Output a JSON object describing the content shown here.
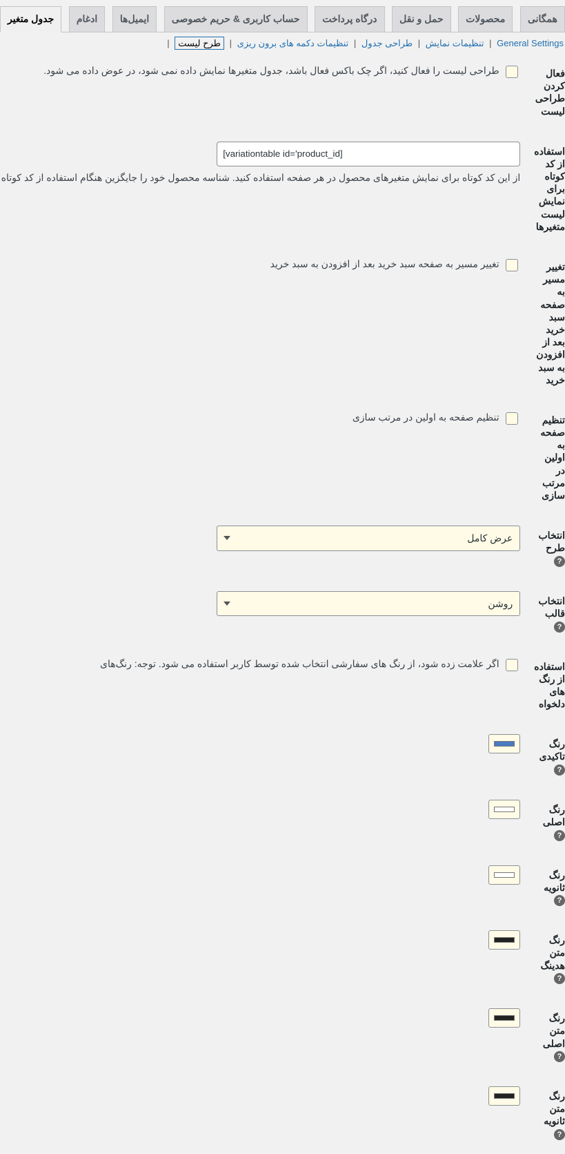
{
  "tabs": {
    "items": [
      {
        "label": "همگانی"
      },
      {
        "label": "محصولات"
      },
      {
        "label": "حمل و نقل"
      },
      {
        "label": "درگاه پرداخت"
      },
      {
        "label": "حساب کاربری & حریم خصوصی"
      },
      {
        "label": "ایمیل‌ها"
      },
      {
        "label": "ادغام"
      },
      {
        "label": "جدول متغیر"
      }
    ],
    "activeIndex": 7
  },
  "sublinks": {
    "items": [
      {
        "label": "General Settings"
      },
      {
        "label": "تنظیمات نمایش"
      },
      {
        "label": "طراحی جدول"
      },
      {
        "label": "تنظیمات دکمه های برون ریزی"
      },
      {
        "label": "طرح لیست"
      }
    ],
    "activeIndex": 4,
    "sep": "|"
  },
  "fields": {
    "enable_list": {
      "label": "فعال کردن طراحی لیست",
      "desc": "طراحی لیست را فعال کنید، اگر چک باکس فعال باشد، جدول متغیرها نمایش داده نمی شود، در عوض داده می شود."
    },
    "shortcode": {
      "label": "استفاده از کد کوتاه برای نمایش لیست متغیرها",
      "value": "[variationtable id='product_id]",
      "desc": "از این کد کوتاه برای نمایش متغیرهای محصول در هر صفحه استفاده کنید. شناسه محصول خود را جایگزین هنگام استفاده از کد کوتاه در المان، می توانید از کد کوتاه ساده [show_product_variation_table] استفاد"
    },
    "redirect_cart": {
      "label": "تغییر مسیر به صفحه سبد خرید بعد از افزودن به سبد خرید",
      "desc": "تغییر مسیر به صفحه سبد خرید بعد از افزودن به سبد خرید"
    },
    "set_page_first": {
      "label": "تنظیم صفحه به اولین در مرتب سازی",
      "desc": "تنظیم صفحه به اولین در مرتب سازی"
    },
    "layout_select": {
      "label": "انتخاب طرح",
      "value": "عرض کامل"
    },
    "template_select": {
      "label": "انتخاب قالب",
      "value": "روشن"
    },
    "custom_colors": {
      "label": "استفاده از رنگ های دلخواه",
      "desc": "اگر علامت زده شود، از رنگ های سفارشی انتخاب شده توسط کاربر استفاده می شود. توجه: رنگ‌های"
    },
    "colors": {
      "accent": {
        "label": "رنگ تاکیدی",
        "hex": "#4a7ac2"
      },
      "primary": {
        "label": "رنگ اصلی",
        "hex": "#ffffff"
      },
      "secondary": {
        "label": "رنگ ثانویه",
        "hex": "#ffffff"
      },
      "heading_txt": {
        "label": "رنگ متن هدینگ",
        "hex": "#222222"
      },
      "main_txt": {
        "label": "رنگ متن اصلی",
        "hex": "#222222"
      },
      "sec_txt": {
        "label": "رنگ متن ثانویه",
        "hex": "#222222"
      }
    }
  },
  "icons": {
    "help": "?"
  }
}
